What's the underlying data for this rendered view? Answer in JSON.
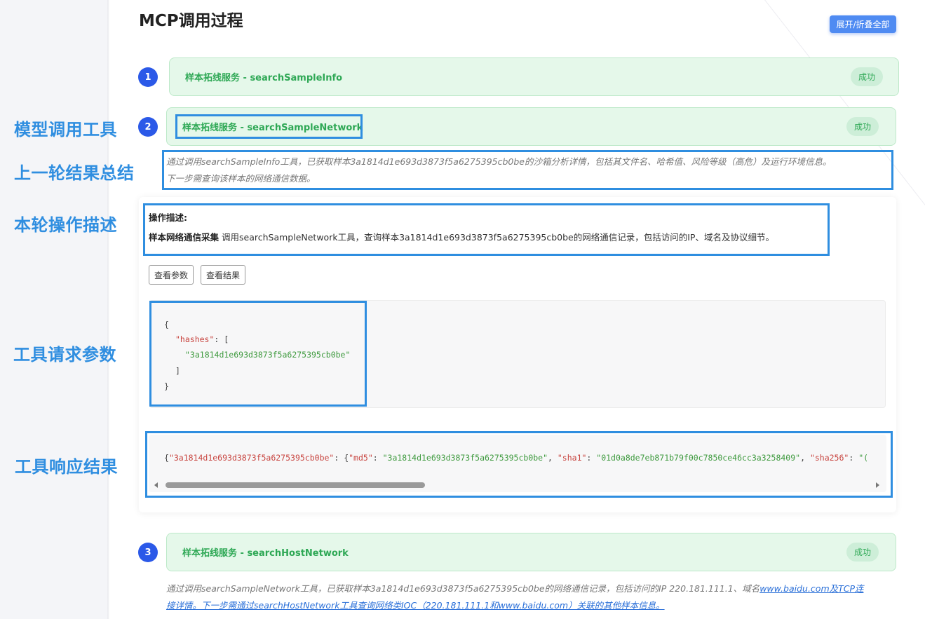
{
  "page": {
    "title": "MCP调用过程",
    "expand_all_label": "展开/折叠全部"
  },
  "steps": [
    {
      "number": "1",
      "title": "样本拓线服务 - searchSampleInfo",
      "status": "成功"
    },
    {
      "number": "2",
      "title": "样本拓线服务 - searchSampleNetwork",
      "status": "成功",
      "summary_line1": "通过调用searchSampleInfo工具，已获取样本3a1814d1e693d3873f5a6275395cb0be的沙箱分析详情，包括其文件名、哈希值、风险等级（高危）及运行环境信息。",
      "summary_line2": "下一步需查询该样本的网络通信数据。",
      "operation": {
        "label": "操作描述:",
        "name": "样本网络通信采集",
        "text": " 调用searchSampleNetwork工具，查询样本3a1814d1e693d3873f5a6275395cb0be的网络通信记录，包括访问的IP、域名及协议细节。"
      },
      "buttons": {
        "view_params": "查看参数",
        "view_result": "查看结果"
      },
      "params": {
        "open_brace": "{",
        "key": "\"hashes\"",
        "colon_bracket": ": [",
        "value": "\"3a1814d1e693d3873f5a6275395cb0be\"",
        "close_bracket": "]",
        "close_brace": "}"
      },
      "result": {
        "p1": "{",
        "k1": "\"3a1814d1e693d3873f5a6275395cb0be\"",
        "p2": ": {",
        "k2": "\"md5\"",
        "p3": ": ",
        "v2": "\"3a1814d1e693d3873f5a6275395cb0be\"",
        "p4": ", ",
        "k3": "\"sha1\"",
        "p5": ": ",
        "v3": "\"01d0a8de7eb871b79f00c7850ce46cc3a3258409\"",
        "p6": ", ",
        "k4": "\"sha256\"",
        "p7": ": ",
        "v4": "\"("
      }
    },
    {
      "number": "3",
      "title": "样本拓线服务 - searchHostNetwork",
      "status": "成功",
      "summary_part1": "通过调用searchSampleNetwork工具，已获取样本3a1814d1e693d3873f5a6275395cb0be的网络通信记录，包括访问的IP 220.181.111.1、域名",
      "summary_link1": "www.baidu.com及TCP连",
      "summary_link2": "接详情。下一步需通过searchHostNetwork工具查询网络类IOC（220.181.111.1和www.baidu.com）关联的其他样本信息。"
    }
  ],
  "annotations": {
    "model_call_tool": "模型调用工具",
    "prev_round_summary": "上一轮结果总结",
    "this_round_desc": "本轮操作描述",
    "tool_request_params": "工具请求参数",
    "tool_response_result": "工具响应结果",
    "color": "#2f8ee0"
  },
  "colors": {
    "step_number_bg": "#2b59e8",
    "success_green": "#2ea855",
    "header_bg": "#e5f8ea",
    "button_blue": "#4f8bf2"
  }
}
